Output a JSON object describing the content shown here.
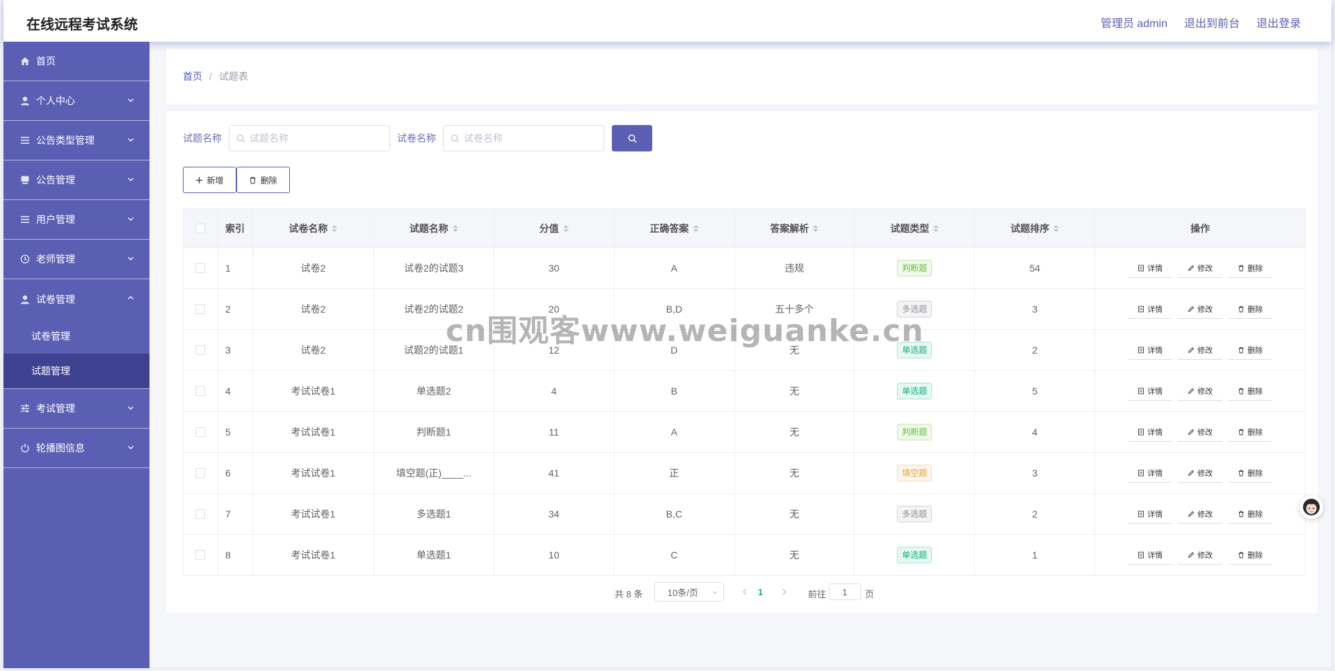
{
  "header": {
    "title": "在线远程考试系统",
    "admin_label": "管理员 admin",
    "to_front_label": "退出到前台",
    "logout_label": "退出登录"
  },
  "sidebar": {
    "items": [
      {
        "label": "首页",
        "icon": "home-icon"
      },
      {
        "label": "个人中心",
        "icon": "user-icon"
      },
      {
        "label": "公告类型管理",
        "icon": "list-icon"
      },
      {
        "label": "公告管理",
        "icon": "monitor-icon"
      },
      {
        "label": "用户管理",
        "icon": "list-icon"
      },
      {
        "label": "老师管理",
        "icon": "clock-icon"
      },
      {
        "label": "试卷管理",
        "icon": "user-icon"
      },
      {
        "label": "考试管理",
        "icon": "sliders-icon"
      },
      {
        "label": "轮播图信息",
        "icon": "power-icon"
      }
    ],
    "submenu": [
      "试卷管理",
      "试题管理"
    ]
  },
  "breadcrumb": {
    "home": "首页",
    "separator": "/",
    "current": "试题表"
  },
  "search": {
    "question_label": "试题名称",
    "question_placeholder": "试题名称",
    "paper_label": "试卷名称",
    "paper_placeholder": "试卷名称"
  },
  "actions": {
    "add_label": "新增",
    "delete_label": "删除"
  },
  "table": {
    "columns": [
      "索引",
      "试卷名称",
      "试题名称",
      "分值",
      "正确答案",
      "答案解析",
      "试题类型",
      "试题排序",
      "操作"
    ],
    "op_labels": {
      "detail": "详情",
      "edit": "修改",
      "delete": "删除"
    },
    "rows": [
      {
        "index": "1",
        "paper": "试卷2",
        "question": "试卷2的试题3",
        "score": "30",
        "answer": "A",
        "analysis": "违规",
        "type": "判断题",
        "type_kind": "judge",
        "order": "54"
      },
      {
        "index": "2",
        "paper": "试卷2",
        "question": "试卷2的试题2",
        "score": "20",
        "answer": "B,D",
        "analysis": "五十多个",
        "type": "多选题",
        "type_kind": "multi",
        "order": "3"
      },
      {
        "index": "3",
        "paper": "试卷2",
        "question": "试题2的试题1",
        "score": "12",
        "answer": "D",
        "analysis": "无",
        "type": "单选题",
        "type_kind": "single",
        "order": "2"
      },
      {
        "index": "4",
        "paper": "考试试卷1",
        "question": "单选题2",
        "score": "4",
        "answer": "B",
        "analysis": "无",
        "type": "单选题",
        "type_kind": "single",
        "order": "5"
      },
      {
        "index": "5",
        "paper": "考试试卷1",
        "question": "判断题1",
        "score": "11",
        "answer": "A",
        "analysis": "无",
        "type": "判断题",
        "type_kind": "judge",
        "order": "4"
      },
      {
        "index": "6",
        "paper": "考试试卷1",
        "question": "填空题(正)____...",
        "score": "41",
        "answer": "正",
        "analysis": "无",
        "type": "填空题",
        "type_kind": "fill",
        "order": "3"
      },
      {
        "index": "7",
        "paper": "考试试卷1",
        "question": "多选题1",
        "score": "34",
        "answer": "B,C",
        "analysis": "无",
        "type": "多选题",
        "type_kind": "multi",
        "order": "2"
      },
      {
        "index": "8",
        "paper": "考试试卷1",
        "question": "单选题1",
        "score": "10",
        "answer": "C",
        "analysis": "无",
        "type": "单选题",
        "type_kind": "single",
        "order": "1"
      }
    ]
  },
  "pagination": {
    "total": "共 8 条",
    "page_size": "10条/页",
    "current_page": "1",
    "goto_label": "前往",
    "goto_value": "1",
    "page_label": "页"
  },
  "watermark": "cn围观客www.weiguanke.cn",
  "colors": {
    "accent": "#5b5fb4",
    "sidebar_active": "#3f4290",
    "success": "#13b07f"
  }
}
